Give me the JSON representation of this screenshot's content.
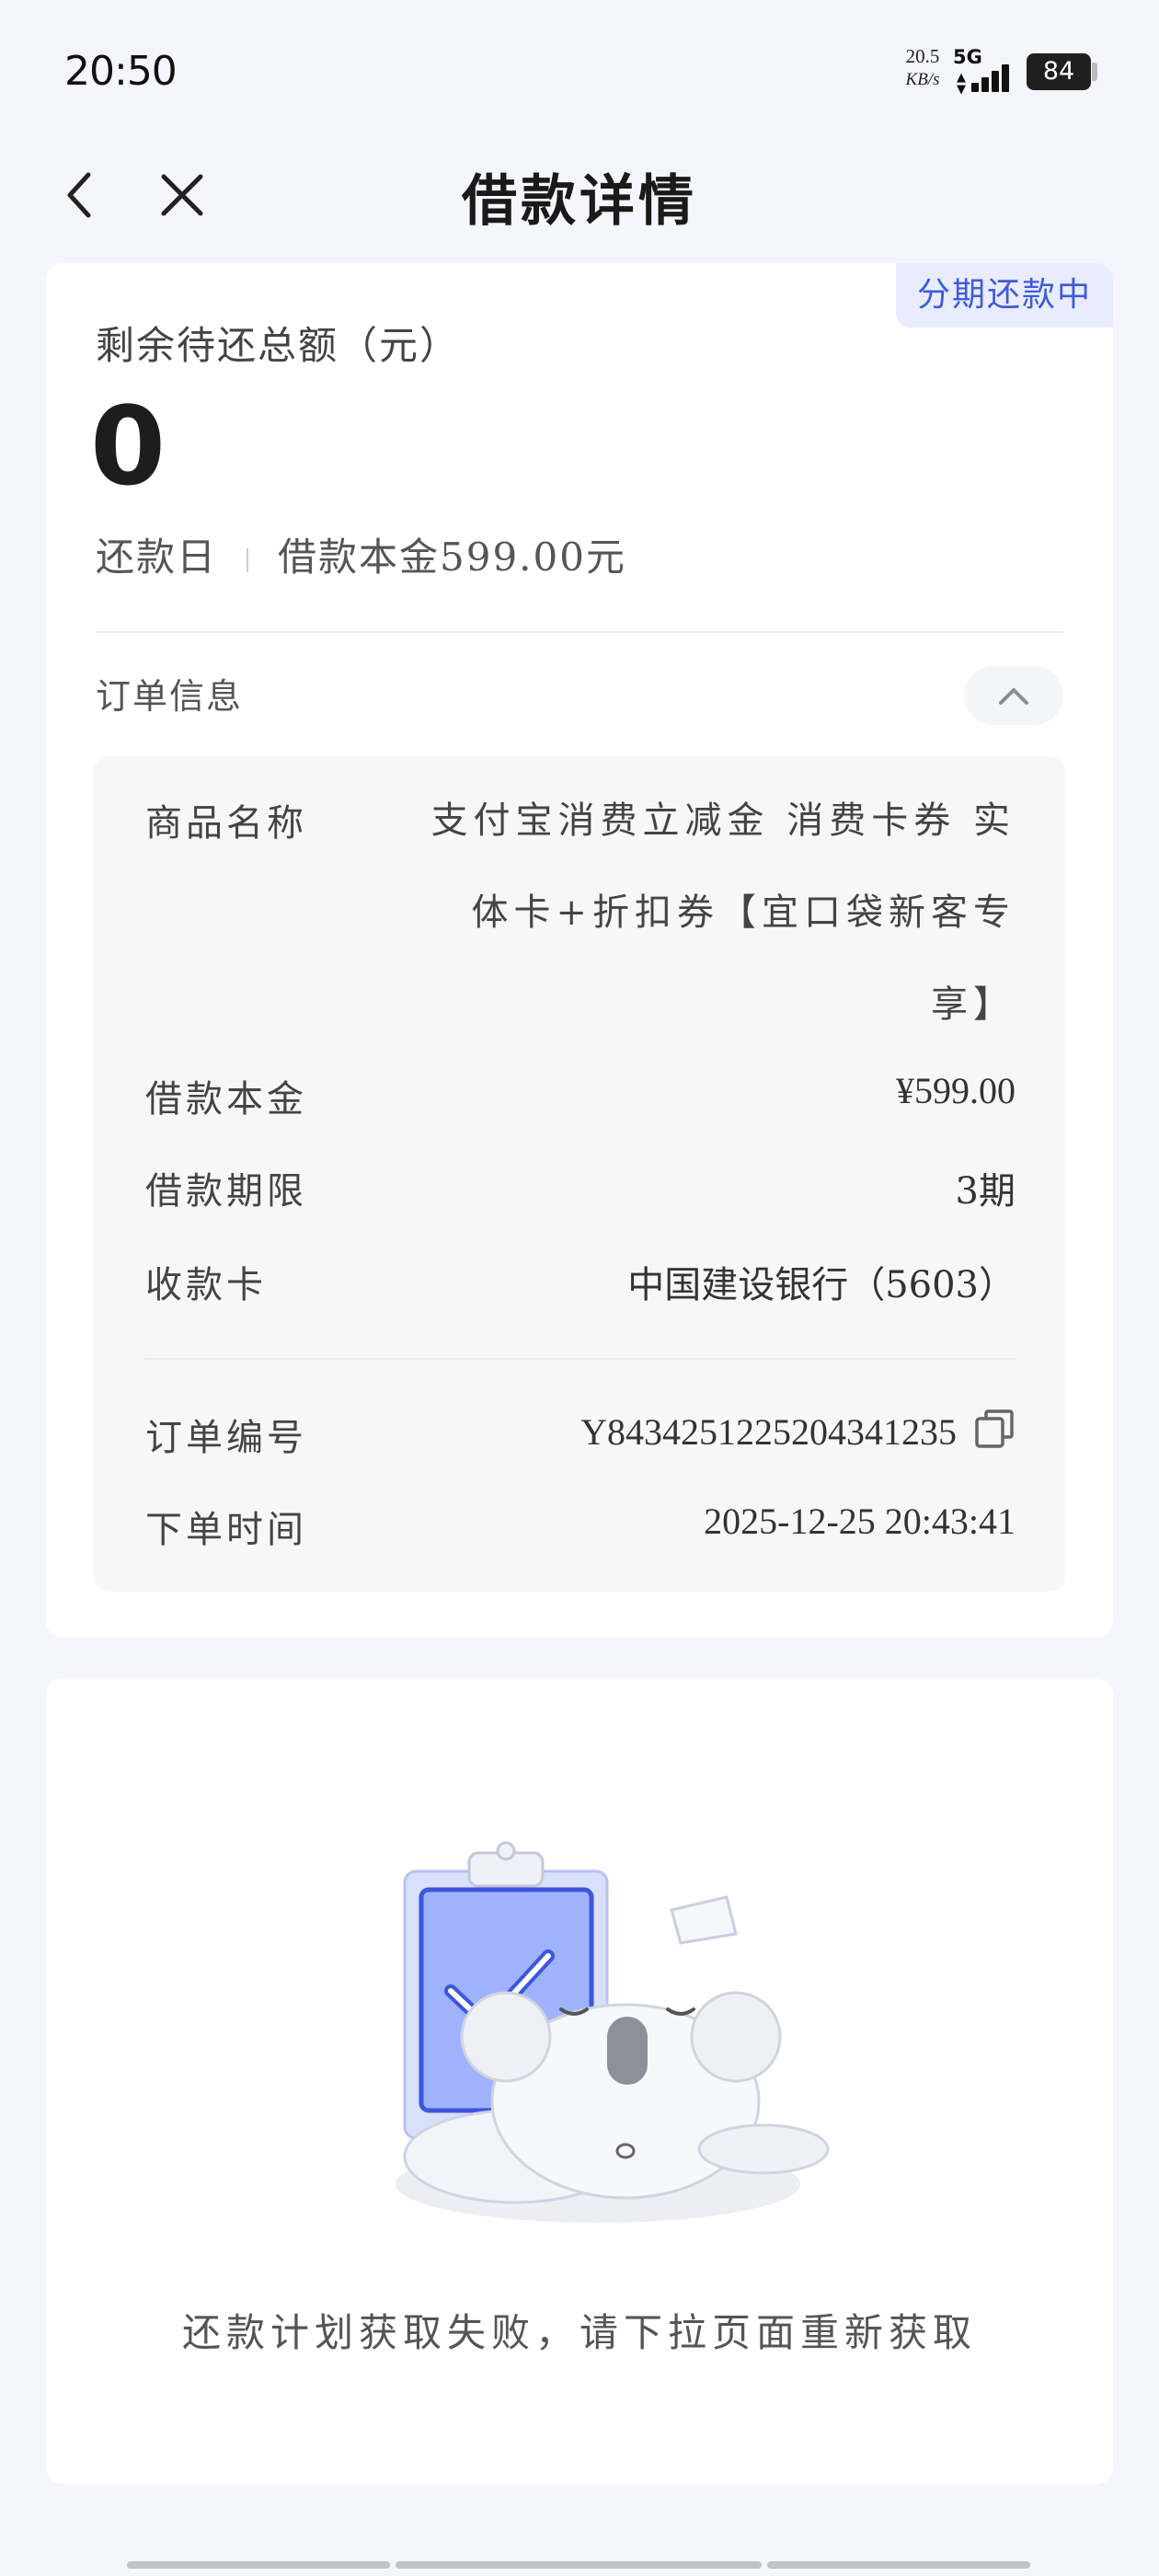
{
  "status_bar": {
    "time": "20:50",
    "net_speed_value": "20.5",
    "net_speed_unit": "KB/s",
    "network": "5G",
    "battery": "84"
  },
  "nav": {
    "title": "借款详情",
    "back_icon": "chevron-left-icon",
    "close_icon": "close-icon"
  },
  "summary": {
    "status_badge": "分期还款中",
    "remaining_label": "剩余待还总额（元）",
    "remaining_amount": "0",
    "repay_day_label": "还款日",
    "principal_text": "借款本金599.00元"
  },
  "order_info": {
    "section_label": "订单信息",
    "collapse_icon": "chevron-up-icon",
    "product_name_label": "商品名称",
    "product_name_value": "支付宝消费立减金 消费卡券 实体卡+折扣券【宜口袋新客专享】",
    "principal_label": "借款本金",
    "principal_value": "¥599.00",
    "term_label": "借款期限",
    "term_value": "3期",
    "card_label": "收款卡",
    "card_value": "中国建设银行（5603）",
    "order_no_label": "订单编号",
    "order_no_value": "Y8434251225204341235",
    "order_time_label": "下单时间",
    "order_time_value": "2025-12-25 20:43:41",
    "copy_icon": "copy-icon"
  },
  "repay_plan": {
    "empty_message": "还款计划获取失败，请下拉页面重新获取",
    "illustration": "sleeping-koala-clipboard-illustration"
  },
  "colors": {
    "accent": "#3f5bd9",
    "badge_bg": "#e8ecfd",
    "page_bg": "#f5f6fb"
  }
}
